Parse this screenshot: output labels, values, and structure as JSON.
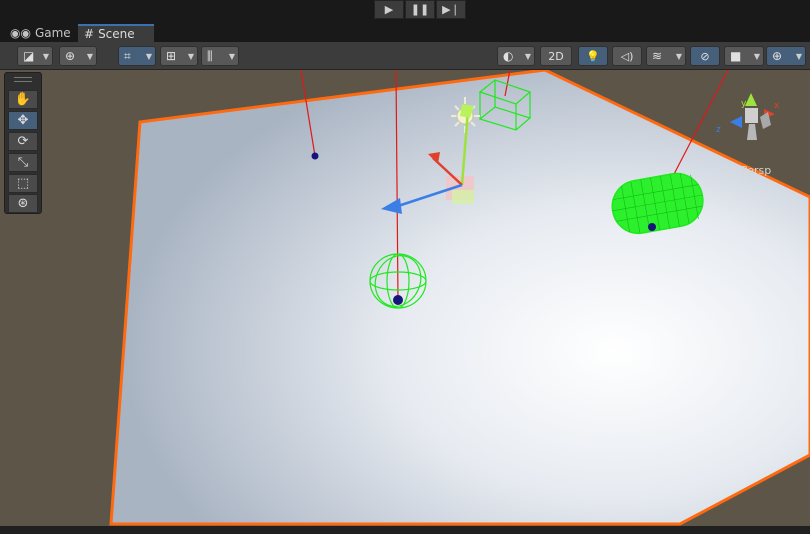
{
  "playbar": {
    "play_icon": "play-icon",
    "pause_icon": "pause-icon",
    "step_icon": "step-icon"
  },
  "tabs": [
    {
      "label": "Game",
      "icon": "gamepad-icon"
    },
    {
      "label": "Scene",
      "icon": "hash-icon",
      "active": true
    }
  ],
  "toolbar": {
    "mode_2d_label": "2D",
    "left_buttons": [
      "draw-mode",
      "pivot-global",
      "move-snap",
      "grid-snap",
      "increment-snap"
    ],
    "right_buttons": [
      "shading",
      "2d",
      "lighting",
      "audio",
      "effects",
      "visibility",
      "camera",
      "gizmos"
    ]
  },
  "tools": [
    "hand",
    "move",
    "rotate",
    "scale",
    "rect",
    "transform"
  ],
  "scene": {
    "gizmo_projection_label": "Persp",
    "axis_labels": {
      "y": "y",
      "z": "z",
      "x": "x"
    },
    "colors": {
      "ground": "#5d5548",
      "plane_outline": "#ff6a10",
      "wireframe": "#1fe81f",
      "raycast": "#e01818",
      "x_axis": "#e0412c",
      "y_axis": "#9de23d",
      "z_axis": "#3b7fe6"
    }
  }
}
